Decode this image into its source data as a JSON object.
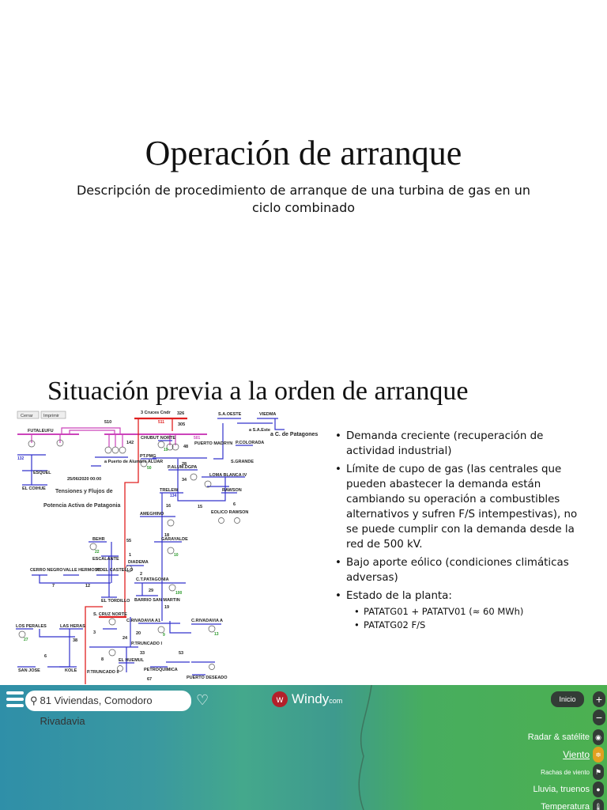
{
  "slide1": {
    "title": "Operación de arranque",
    "subtitle": "Descripción de procedimiento de arranque de una turbina de gas en un ciclo combinado"
  },
  "slide2": {
    "title": "Situación previa a la orden de arranque",
    "diagram": {
      "buttons": {
        "close": "Cerrar",
        "print": "Imprimir"
      },
      "heading1": "Tensiones y Flujos de",
      "heading2": "Potencia Activa de Patagonia",
      "date": "25/06/2020 00:00",
      "labels": [
        "FUTALEUFU",
        "3 Cruces Cndr",
        "CHUBUT NORTE",
        "S.A.OESTE",
        "VIEDMA",
        "PUERTO MADRYN",
        "P.COLORADA",
        "S.GRANDE",
        "ESQUEL",
        "EL COIHUE",
        "a Puerto de Alumbre ALUAR",
        "PT.PMG",
        "P.ALUM.DGPA",
        "LOMA BLANCA IV",
        "TRELEW",
        "RAWSON",
        "EOLICO RAWSON",
        "AMEGHINO",
        "GARAYALDE",
        "BEHR",
        "ESCALANTE",
        "DIADEMA",
        "CERRO NEGRO",
        "VALLE HERMOSO",
        "ROEL CASTELLO",
        "C.T.PATAGONIA",
        "BARRIO SAN MARTIN",
        "EL TORDILLO",
        "S. CRUZ NORTE",
        "C.RIVADAVIA A1",
        "C.RIVADAVIA A",
        "LOS PERALES",
        "LAS HERAS",
        "P.TRUNCADO I",
        "SAN JOSE",
        "KOLE",
        "EL HUEMUL",
        "P.TRUNCADO II",
        "PETROQUIMICA",
        "PUERTO DESEADO",
        "a S.A.Este",
        "a C. de Patagones"
      ],
      "numbers": [
        "510",
        "326",
        "305",
        "511",
        "501",
        "142",
        "48",
        "19",
        "50",
        "132",
        "134",
        "28",
        "34",
        "16",
        "15",
        "6",
        "18",
        "10",
        "55",
        "22",
        "1",
        "2",
        "29",
        "100",
        "7",
        "12",
        "19",
        "9",
        "20",
        "24",
        "33",
        "53",
        "67",
        "13",
        "27",
        "3",
        "38",
        "6",
        "8"
      ]
    },
    "bullets": [
      {
        "text": "Demanda creciente (recuperación de actividad industrial)"
      },
      {
        "text": "Límite de cupo de gas (las centrales que pueden abastecer la demanda están cambiando su operación a combustibles alternativos y sufren F/S intempestivas), no se puede cumplir con la demanda desde la red de 500 kV."
      },
      {
        "text": "Bajo aporte eólico (condiciones climáticas adversas)"
      },
      {
        "text": "Estado de la planta:",
        "sub": [
          "PATATG01 + PATATV01 (≈ 60 MWh)",
          "PATATG02 F/S"
        ]
      }
    ]
  },
  "windy": {
    "search_value": "81 Viviendas, Comodoro Rivadavia",
    "logo": "Windy",
    "logo_suffix": "com",
    "home": "Inicio",
    "zoom_in": "+",
    "zoom_out": "−",
    "layers": [
      {
        "label": "Radar & satélite",
        "icon": "radar-icon"
      },
      {
        "label": "Viento",
        "icon": "wind-icon",
        "active": true
      },
      {
        "label": "Rachas de viento",
        "icon": "flag-icon"
      },
      {
        "label": "Lluvia, truenos",
        "icon": "drop-icon"
      },
      {
        "label": "Temperatura",
        "icon": "thermometer-icon"
      }
    ],
    "colors": {
      "accent": "#e0a020",
      "logo": "#b3202a"
    }
  }
}
